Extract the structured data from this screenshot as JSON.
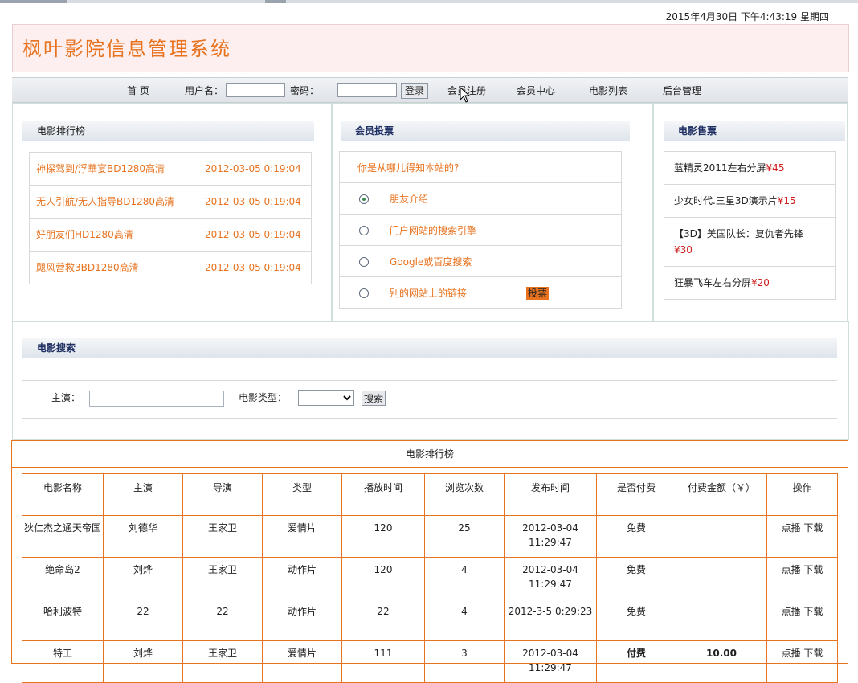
{
  "datetime": "2015年4月30日  下午4:43:19  星期四",
  "app_title": "枫叶影院信息管理系统",
  "nav": {
    "home": "首 页",
    "username_label": "用户名：",
    "password_label": "密码：",
    "login": "登录",
    "register": "会员注册",
    "member_center": "会员中心",
    "movie_list": "电影列表",
    "admin": "后台管理"
  },
  "ranking": {
    "title": "电影排行榜",
    "items": [
      {
        "name": "神探驾到/浮華宴BD1280高清",
        "time": "2012-03-05 0:19:04"
      },
      {
        "name": "无人引航/无人指导BD1280高清",
        "time": "2012-03-05 0:19:04"
      },
      {
        "name": "好朋友们HD1280高清",
        "time": "2012-03-05 0:19:04"
      },
      {
        "name": "飓风营救3BD1280高清",
        "time": "2012-03-05 0:19:04"
      }
    ]
  },
  "vote": {
    "title": "会员投票",
    "question": "你是从哪儿得知本站的?",
    "options": [
      "朋友介绍",
      "门户网站的搜索引擎",
      "Google或百度搜索",
      "别的网站上的链接"
    ],
    "submit": "投票"
  },
  "tickets": {
    "title": "电影售票",
    "items": [
      {
        "name": "蓝精灵2011左右分屏",
        "price": "¥45"
      },
      {
        "name": "少女时代.三星3D演示片",
        "price": "¥15"
      },
      {
        "name": "【3D】美国队长：复仇者先锋",
        "price": "¥30"
      },
      {
        "name": "狂暴飞车左右分屏",
        "price": "¥20"
      }
    ]
  },
  "search": {
    "title": "电影搜索",
    "actor_label": "主演：",
    "type_label": "电影类型：",
    "button": "搜索"
  },
  "film_list": {
    "title": "电影排行榜",
    "headers": [
      "电影名称",
      "主演",
      "导演",
      "类型",
      "播放时间",
      "浏览次数",
      "发布时间",
      "是否付费",
      "付费金额（￥）",
      "操作"
    ],
    "rows": [
      {
        "name": "狄仁杰之通天帝国",
        "actor": "刘德华",
        "director": "王家卫",
        "type": "爱情片",
        "duration": "120",
        "views": "25",
        "published": "2012-03-04 11:29:47",
        "paid": "免费",
        "amount": "",
        "play": "点播",
        "download": "下载"
      },
      {
        "name": "绝命岛2",
        "actor": "刘烨",
        "director": "王家卫",
        "type": "动作片",
        "duration": "120",
        "views": "4",
        "published": "2012-03-04 11:29:47",
        "paid": "免费",
        "amount": "",
        "play": "点播",
        "download": "下载"
      },
      {
        "name": "哈利波特",
        "actor": "22",
        "director": "22",
        "type": "动作片",
        "duration": "22",
        "views": "4",
        "published": "2012-3-5 0:29:23",
        "paid": "免费",
        "amount": "",
        "play": "点播",
        "download": "下载"
      },
      {
        "name": "特工",
        "actor": "刘烨",
        "director": "王家卫",
        "type": "爱情片",
        "duration": "111",
        "views": "3",
        "published": "2012-03-04 11:29:47",
        "paid": "付费",
        "amount": "10.00",
        "play": "点播",
        "download": "下载"
      }
    ]
  }
}
